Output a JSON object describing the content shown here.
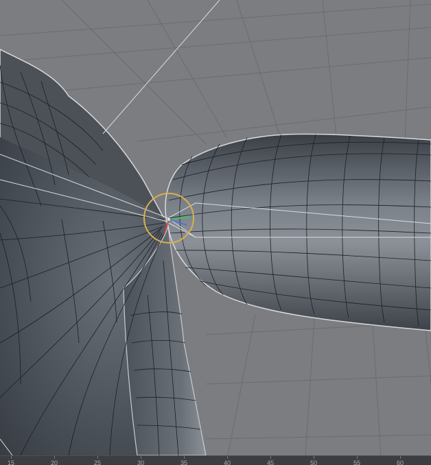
{
  "viewport": {
    "background_color": "#7b7d80",
    "grid_color": "#6a6c6f",
    "mesh_color": "#4b5057",
    "wire_color": "#1c1f23",
    "rig_line_color": "#d9dde0",
    "pivot_color": "#d8b24a",
    "axis_x_color": "#d2463b",
    "axis_y_color": "#42c25d",
    "axis_z_color": "#4a6ee8"
  },
  "timeline": {
    "labels": [
      "15",
      "20",
      "25",
      "30",
      "35",
      "40",
      "45",
      "50",
      "55",
      "60"
    ]
  }
}
